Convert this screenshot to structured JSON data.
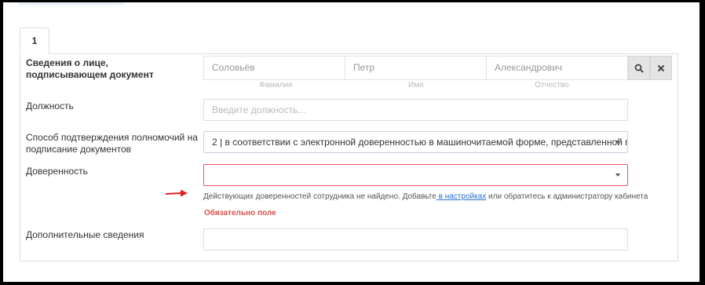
{
  "tab": {
    "label": "1"
  },
  "signer": {
    "label": "Сведения о лице, подписывающем документ",
    "last_name": "Соловьёв",
    "first_name": "Петр",
    "middle_name": "Александрович",
    "last_name_hint": "Фамилия",
    "first_name_hint": "Имя",
    "middle_name_hint": "Отчество",
    "search_icon": "search-icon",
    "clear_icon": "close-icon"
  },
  "position": {
    "label": "Должность",
    "placeholder": "Введите должность..."
  },
  "authority": {
    "label": "Способ подтверждения полномочий на подписание документов",
    "value": "2 | в соответствии с электронной доверенностью в машиночитаемой форме, представленной посредс"
  },
  "poa": {
    "label": "Доверенность",
    "value": "",
    "help_before": "Действующих доверенностей сотрудника не найдено. Добавьте",
    "help_link": " в настройках",
    "help_after": " или обратитесь к администратору кабинета",
    "error": "Обязательно поле"
  },
  "extra": {
    "label": "Дополнительные сведения",
    "value": ""
  },
  "colors": {
    "error": "#d9534f",
    "link": "#2a6fc9",
    "arrow": "#e02020"
  }
}
